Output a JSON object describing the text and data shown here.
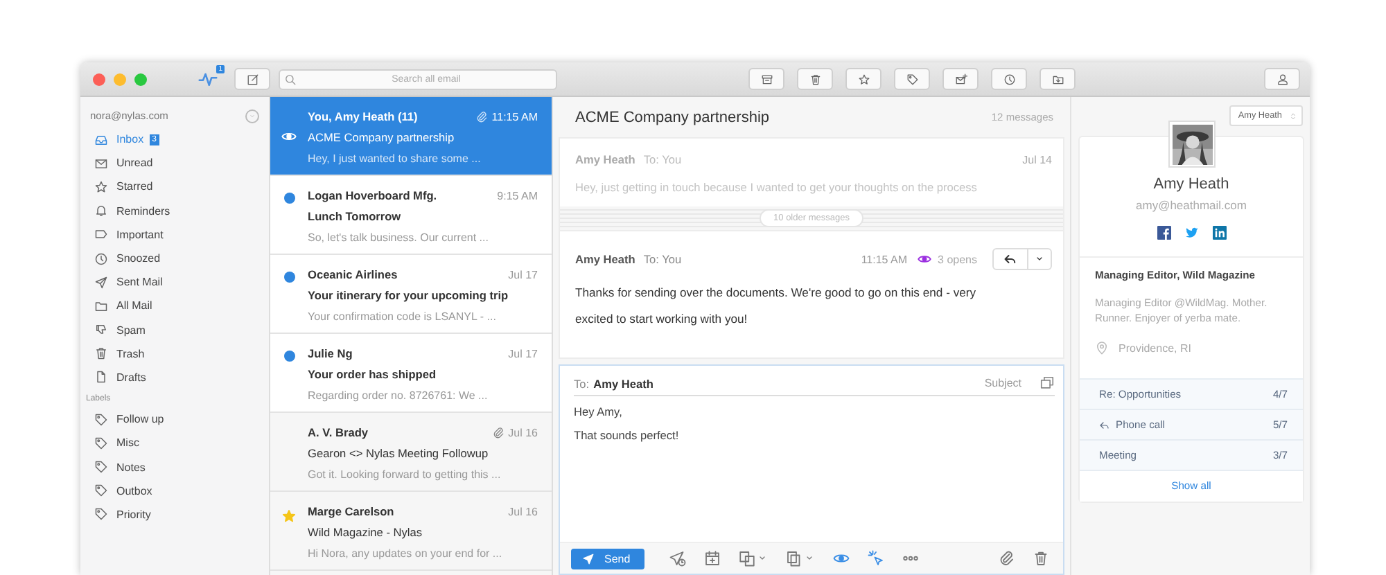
{
  "toolbar": {
    "activity_badge": "1",
    "search": {
      "placeholder": "Search all email"
    }
  },
  "sidebar": {
    "account": "nora@nylas.com",
    "items": [
      {
        "label": "Inbox",
        "count": "3",
        "selected": true
      },
      {
        "label": "Unread",
        "selected": false
      },
      {
        "label": "Starred",
        "selected": false
      },
      {
        "label": "Reminders",
        "selected": false
      },
      {
        "label": "Important",
        "selected": false
      },
      {
        "label": "Snoozed",
        "selected": false
      },
      {
        "label": "Sent Mail",
        "selected": false
      },
      {
        "label": "All Mail",
        "selected": false
      },
      {
        "label": "Spam",
        "selected": false
      },
      {
        "label": "Trash",
        "selected": false
      },
      {
        "label": "Drafts",
        "selected": false
      }
    ],
    "labels_heading": "Labels",
    "labels": [
      {
        "label": "Follow up",
        "selected": false
      },
      {
        "label": "Misc",
        "selected": false
      },
      {
        "label": "Notes",
        "selected": false
      },
      {
        "label": "Outbox",
        "selected": false
      },
      {
        "label": "Priority",
        "selected": false
      }
    ]
  },
  "threads": [
    {
      "from": "You, Amy Heath (11)",
      "time": "11:15 AM",
      "subject": "ACME Company partnership",
      "snippet": "Hey, I just wanted to share some ...",
      "selected": true,
      "unread": false,
      "starred": false,
      "tracked": true,
      "attachment": true
    },
    {
      "from": "Logan Hoverboard Mfg.",
      "time": "9:15 AM",
      "subject": "Lunch Tomorrow",
      "snippet": "So, let's talk business. Our current ...",
      "selected": false,
      "unread": true,
      "starred": false,
      "tracked": false,
      "attachment": false
    },
    {
      "from": "Oceanic Airlines",
      "time": "Jul 17",
      "subject": "Your itinerary for your upcoming trip",
      "snippet": "Your confirmation code is LSANYL - ...",
      "selected": false,
      "unread": true,
      "starred": false,
      "tracked": false,
      "attachment": false
    },
    {
      "from": "Julie Ng",
      "time": "Jul 17",
      "subject": "Your order has shipped",
      "snippet": "Regarding order no. 8726761: We ...",
      "selected": false,
      "unread": true,
      "starred": false,
      "tracked": false,
      "attachment": false
    },
    {
      "from": "A. V. Brady",
      "time": "Jul 16",
      "subject": "Gearon <> Nylas Meeting Followup",
      "snippet": "Got it. Looking forward to getting this ...",
      "selected": false,
      "unread": false,
      "starred": false,
      "tracked": false,
      "attachment": true
    },
    {
      "from": "Marge Carelson",
      "time": "Jul 16",
      "subject": "Wild Magazine - Nylas",
      "snippet": "Hi Nora, any updates on your end for ...",
      "selected": false,
      "unread": false,
      "starred": true,
      "tracked": false,
      "attachment": false
    }
  ],
  "conversation": {
    "title": "ACME Company partnership",
    "count": "12 messages",
    "messages": [
      {
        "kind": "collapsed",
        "from": "Amy Heath",
        "to": "To: You",
        "date": "Jul 14",
        "snippet": "Hey, just getting in touch because I wanted to get your thoughts on the process"
      },
      {
        "kind": "older",
        "label": "10 older messages"
      },
      {
        "kind": "expanded",
        "from": "Amy Heath",
        "to": "To: You",
        "date": "11:15 AM",
        "opens": "3 opens",
        "body": "Thanks for sending over the documents. We're good to go on this end - very excited to start working with you!"
      }
    ]
  },
  "composer": {
    "to_label": "To:",
    "to": "Amy Heath",
    "subject": "Subject",
    "body": [
      "Hey Amy,",
      "That sounds perfect!"
    ],
    "send": "Send"
  },
  "contact": {
    "selector": "Amy Heath",
    "name": "Amy Heath",
    "email": "amy@heathmail.com",
    "title": "Managing Editor, Wild Magazine",
    "bio": "Managing Editor @WildMag. Mother. Runner. Enjoyer of yerba mate.",
    "location": "Providence, RI",
    "threads": [
      {
        "label": "Re: Opportunities",
        "count": "4/7",
        "replied": false
      },
      {
        "label": "Phone call",
        "count": "5/7",
        "replied": true
      },
      {
        "label": "Meeting",
        "count": "3/7",
        "replied": false
      }
    ],
    "show_all": "Show all"
  }
}
